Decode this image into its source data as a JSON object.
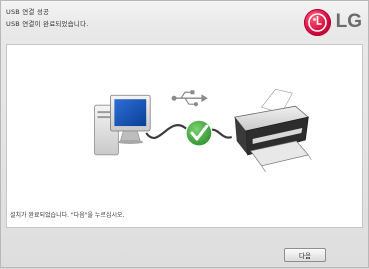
{
  "header": {
    "title": "USB 연결 성공",
    "subtitle": "USB 연결이 완료되었습니다.",
    "logo_text": "LG"
  },
  "main": {
    "message": "설치가 완료되었습니다. \"다음\"을 누르십시오."
  },
  "footer": {
    "next_label": "다음"
  },
  "colors": {
    "lg_red": "#d10a3d",
    "check_green": "#3fa43f"
  }
}
